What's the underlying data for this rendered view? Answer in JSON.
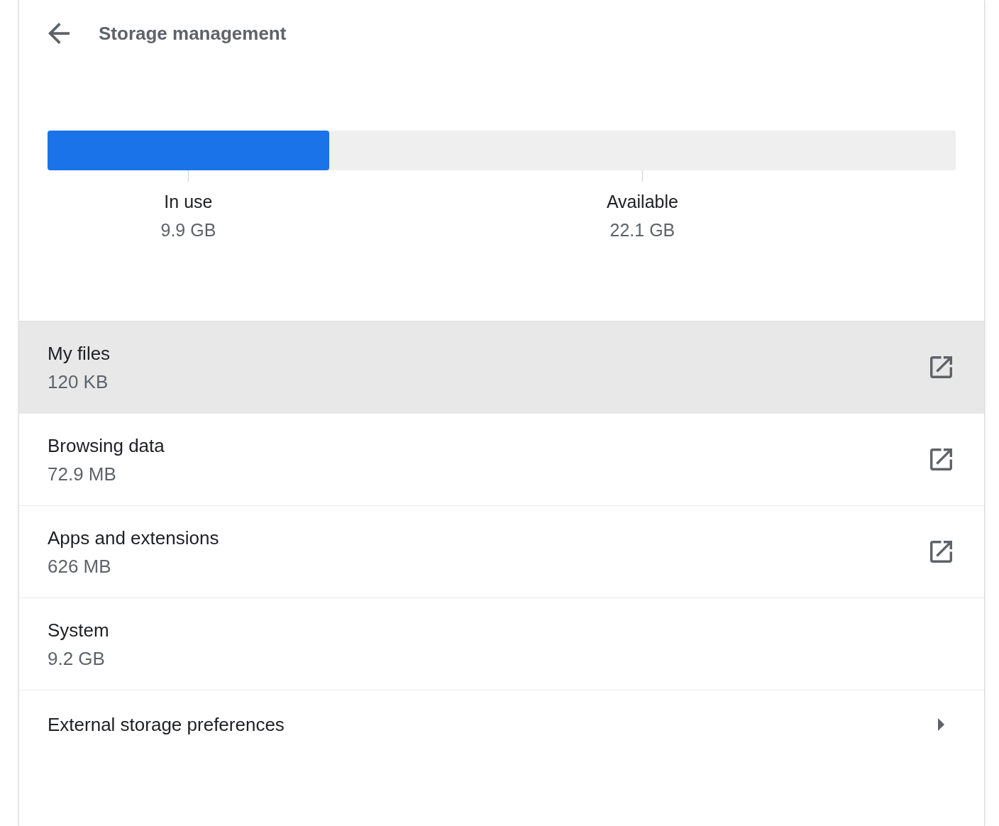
{
  "header": {
    "title": "Storage management"
  },
  "storage": {
    "level": 0.31,
    "legend": [
      {
        "label": "In use",
        "value": "9.9 GB"
      },
      {
        "label": "Available",
        "value": "22.1 GB"
      }
    ]
  },
  "items": [
    {
      "kind": "external",
      "title": "My files",
      "size": "120 KB",
      "selected": true
    },
    {
      "kind": "external",
      "title": "Browsing data",
      "size": "72.9 MB",
      "selected": false
    },
    {
      "kind": "external",
      "title": "Apps and extensions",
      "size": "626 MB",
      "selected": false
    },
    {
      "kind": "plain",
      "title": "System",
      "size": "9.2 GB",
      "selected": false
    },
    {
      "kind": "subpage",
      "title": "External storage preferences",
      "selected": false
    }
  ]
}
